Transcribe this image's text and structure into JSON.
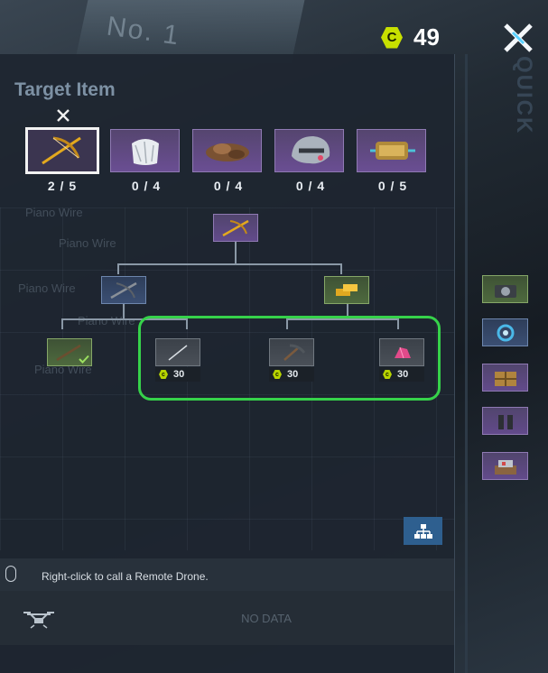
{
  "currency": {
    "icon": "coin-icon",
    "symbol": "C",
    "amount": "49"
  },
  "panel": {
    "title": "Target Item",
    "target_items": [
      {
        "name": "crossbow",
        "count": "2 / 5",
        "selected": true
      },
      {
        "name": "white-fur",
        "count": "0 / 4",
        "selected": false
      },
      {
        "name": "leather-scraps",
        "count": "0 / 4",
        "selected": false
      },
      {
        "name": "helmet",
        "count": "0 / 4",
        "selected": false
      },
      {
        "name": "gold-container",
        "count": "0 / 5",
        "selected": false
      }
    ],
    "ghost_list": [
      "Piano Wire",
      "Piano Wire",
      "Piano Wire",
      "Piano Wire",
      "Piano Wire"
    ],
    "tree": {
      "root": "crossbow-icon",
      "children": [
        "bow-icon",
        "gold-bars-icon"
      ],
      "leaves": [
        {
          "icon": "crossbow-part-icon",
          "owned": true
        },
        {
          "icon": "piano-wire-icon",
          "price": "30"
        },
        {
          "icon": "pickaxe-icon",
          "price": "30"
        },
        {
          "icon": "pink-crystal-icon",
          "price": "30"
        }
      ]
    }
  },
  "hint": {
    "text": "Right-click to call a Remote Drone."
  },
  "drone": {
    "status": "NO DATA"
  },
  "quick": {
    "label": "QUICK",
    "slots": [
      "camera-icon",
      "scanner-icon",
      "crate-icon",
      "gloves-icon",
      "supply-box-icon"
    ]
  },
  "colors": {
    "accent": "#c8e000",
    "highlight": "#36d24a",
    "rare": "#6a4e93"
  }
}
